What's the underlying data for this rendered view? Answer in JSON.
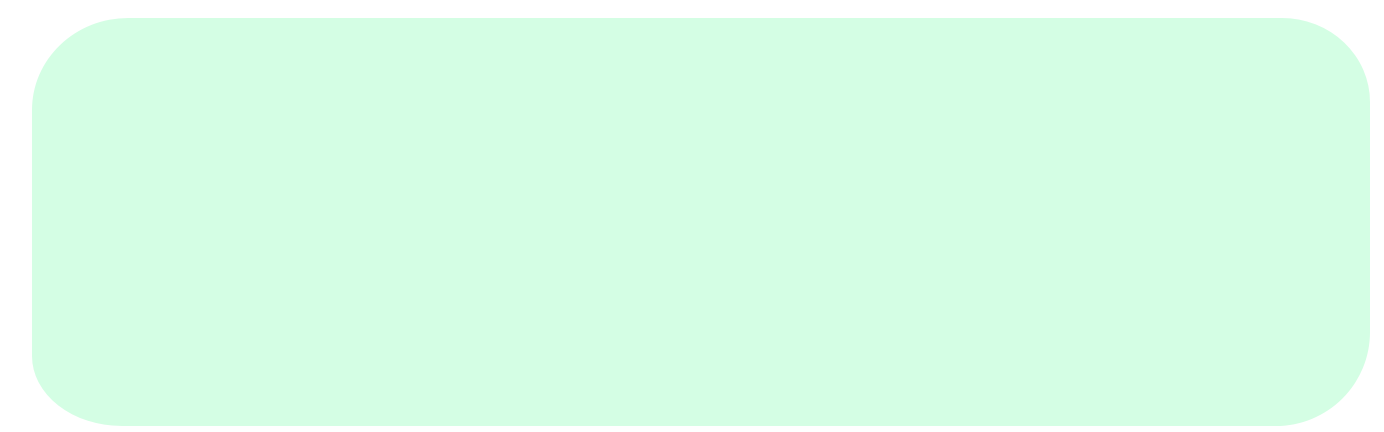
{
  "colors": {
    "background": "#ffffff",
    "card": "#d4fee4"
  }
}
